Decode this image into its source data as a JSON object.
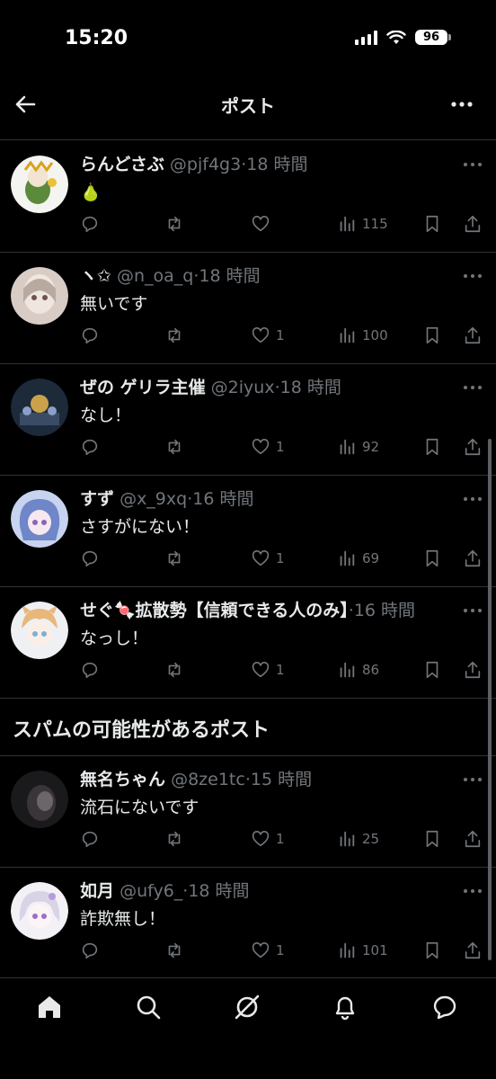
{
  "status_bar": {
    "time": "15:20",
    "battery": "96"
  },
  "header": {
    "title": "ポスト"
  },
  "posts": [
    {
      "name": "らんどさぶ",
      "handle": "@pjf4g3",
      "dot": "·",
      "time": "18 時間",
      "text": "🍐",
      "likes": "",
      "views": "115"
    },
    {
      "name": "ヽ✩",
      "handle": "@n_oa_q",
      "dot": "·",
      "time": "18 時間",
      "text": "無いです",
      "likes": "1",
      "views": "100"
    },
    {
      "name": "ぜの ゲリラ主催",
      "handle": "@2iyux",
      "dot": "·",
      "time": "18 時間",
      "text": "なし！",
      "likes": "1",
      "views": "92"
    },
    {
      "name": "すず",
      "handle": "@x_9xq",
      "dot": "·",
      "time": "16 時間",
      "text": "さすがにない！",
      "likes": "1",
      "views": "69"
    },
    {
      "name": "せぐ🍬拡散勢【信頼できる人のみ】",
      "handle": "",
      "dot": "·",
      "time": "16 時間",
      "text": "なっし！",
      "likes": "1",
      "views": "86"
    }
  ],
  "spam_section": {
    "title": "スパムの可能性があるポスト"
  },
  "spam_posts": [
    {
      "name": "無名ちゃん",
      "handle": "@8ze1tc",
      "dot": "·",
      "time": "15 時間",
      "text": "流石にないです",
      "likes": "1",
      "views": "25"
    },
    {
      "name": "如月",
      "handle": "@ufy6_",
      "dot": "·",
      "time": "18 時間",
      "text": "詐欺無し！",
      "likes": "1",
      "views": "101"
    }
  ],
  "colors": {
    "background": "#000000",
    "text": "#e7e9ea",
    "muted": "#71767b",
    "divider": "#2f3336"
  },
  "tabs": [
    "home-icon",
    "search-icon",
    "grok-icon",
    "notifications-icon",
    "messages-icon"
  ]
}
